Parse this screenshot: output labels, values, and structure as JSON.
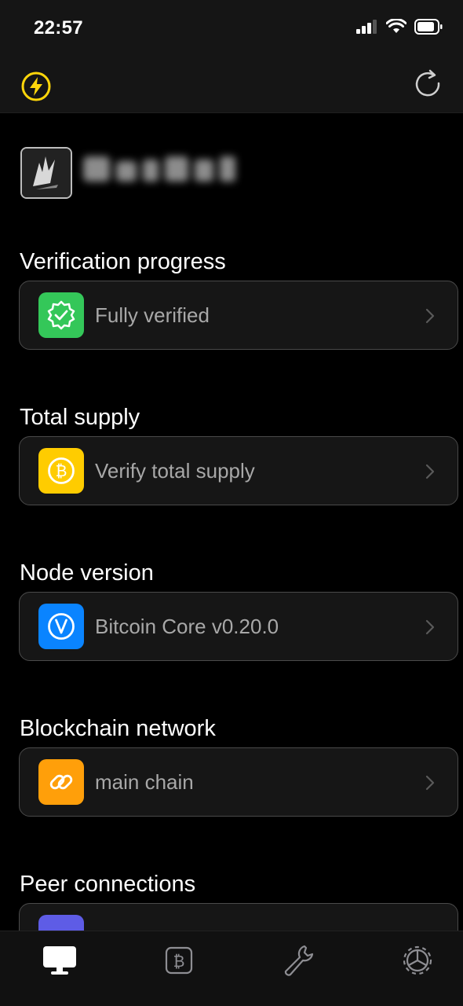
{
  "status_bar": {
    "time": "22:57"
  },
  "sections": [
    {
      "title": "Verification progress",
      "row_label": "Fully verified",
      "icon": "verified-badge-icon",
      "icon_color": "#34c759"
    },
    {
      "title": "Total supply",
      "row_label": "Verify total supply",
      "icon": "bitcoin-coin-icon",
      "icon_color": "#ffcc00"
    },
    {
      "title": "Node version",
      "row_label": "Bitcoin Core v0.20.0",
      "icon": "version-v-icon",
      "icon_color": "#0a84ff"
    },
    {
      "title": "Blockchain network",
      "row_label": "main chain",
      "icon": "link-icon",
      "icon_color": "#ff9f0a"
    },
    {
      "title": "Peer connections",
      "row_label": "",
      "icon": "peers-icon",
      "icon_color": "#5e5ce6"
    }
  ],
  "tabs": [
    {
      "name": "node",
      "icon": "monitor-icon",
      "active": true
    },
    {
      "name": "bitcoin",
      "icon": "bitcoin-icon",
      "active": false
    },
    {
      "name": "tools",
      "icon": "wrench-icon",
      "active": false
    },
    {
      "name": "settings",
      "icon": "gear-icon",
      "active": false
    }
  ],
  "colors": {
    "accent_yellow": "#ffd60a",
    "background": "#000000",
    "card": "#161616"
  }
}
